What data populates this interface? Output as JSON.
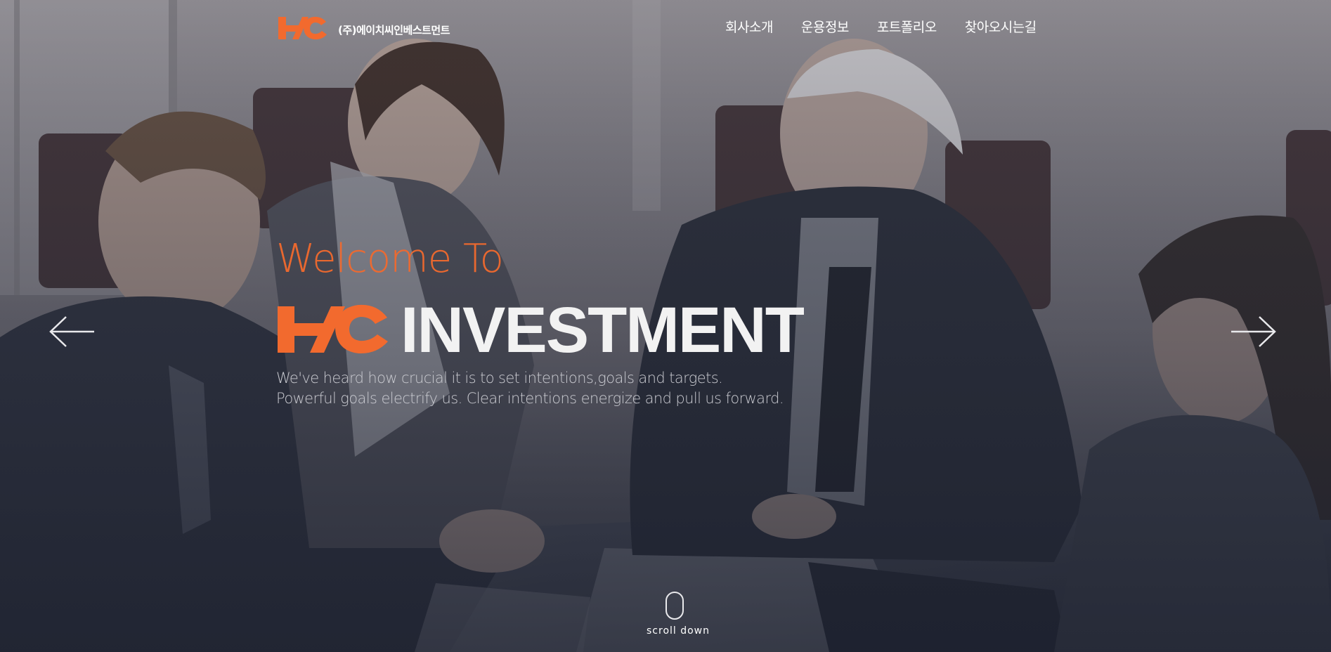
{
  "brand": {
    "logo_icon": "hc-logo-icon",
    "company_name": "(주)에이치씨인베스트먼트",
    "accent_color": "#f26a2e"
  },
  "nav": {
    "items": [
      {
        "label": "회사소개"
      },
      {
        "label": "운용정보"
      },
      {
        "label": "포트폴리오"
      },
      {
        "label": "찾아오시는길"
      }
    ]
  },
  "hero": {
    "welcome": "Welcome To",
    "title": "INVESTMENT",
    "description_line1": "We've heard how crucial it is to set intentions,goals and targets.",
    "description_line2": "Powerful goals electrify us. Clear intentions energize and pull us forward.",
    "background_image": "business-meeting-handshake-photo"
  },
  "controls": {
    "prev_icon": "arrow-left-icon",
    "next_icon": "arrow-right-icon",
    "scroll_icon": "mouse-icon",
    "scroll_label": "scroll down"
  }
}
